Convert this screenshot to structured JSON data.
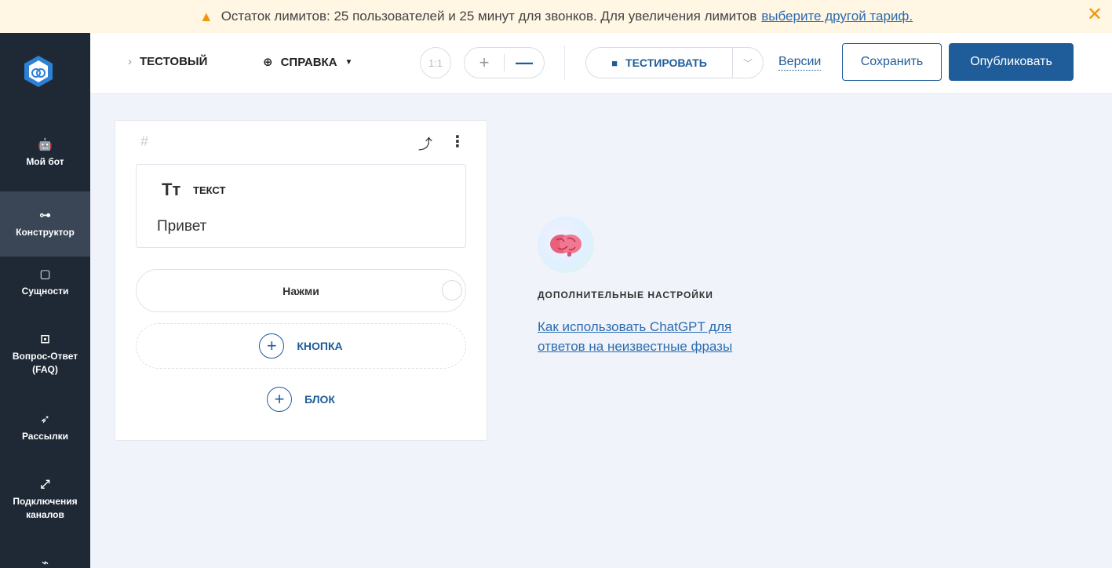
{
  "banner": {
    "message": "Остаток лимитов: 25 пользователей и 25 минут для звонков. Для увеличения лимитов",
    "link": "выберите другой тариф."
  },
  "sidebar": {
    "items": [
      {
        "label": "Мой бот",
        "icon": "robot-icon"
      },
      {
        "label": "Конструктор",
        "icon": "flow-icon",
        "active": true
      },
      {
        "label": "Сущности",
        "icon": "book-icon"
      },
      {
        "label": "Вопрос-Ответ (FAQ)",
        "icon": "faq-icon"
      },
      {
        "label": "Рассылки",
        "icon": "send-icon"
      },
      {
        "label": "Подключения каналов",
        "icon": "plug-icon"
      }
    ]
  },
  "toolbar": {
    "breadcrumb": "ТЕСТОВЫЙ",
    "help": "СПРАВКА",
    "zoom_reset": "1:1",
    "test": "ТЕСТИРОВАТЬ",
    "versions": "Версии",
    "save": "Сохранить",
    "publish": "Опубликовать"
  },
  "block": {
    "id_placeholder": "#",
    "text_label": "ТЕКСТ",
    "text_value": "Привет",
    "button_label": "Нажми",
    "add_button": "КНОПКА",
    "add_block": "БЛОК"
  },
  "settings": {
    "title": "ДОПОЛНИТЕЛЬНЫЕ НАСТРОЙКИ",
    "link": "Как использовать ChatGPT для ответов на неизвестные фразы"
  },
  "colors": {
    "accent": "#1f5c9a",
    "sidebar": "#1f2935",
    "banner_bg": "#fff6e4",
    "warning": "#f0960e",
    "canvas": "#f0f3fa"
  }
}
